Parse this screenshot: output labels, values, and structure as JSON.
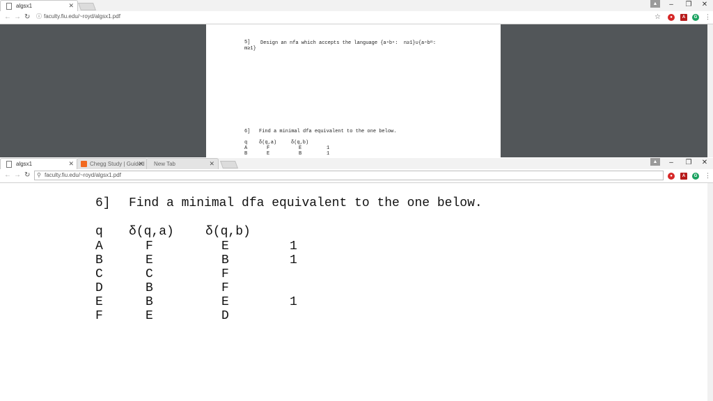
{
  "top_window": {
    "tabs": [
      {
        "title": "algsx1"
      }
    ],
    "url": "faculty.fiu.edu/~royd/algsx1.pdf",
    "pdf": {
      "problem5": {
        "number": "5]",
        "line1": "Design an nfa which accepts the language {aⁿbⁿ:  n≥1}∪{aⁿbᵐ:",
        "line2": "m≥1}"
      },
      "problem6": {
        "number": "6]",
        "text": "Find a minimal dfa equivalent to the one below.",
        "headers": [
          "q",
          "δ(q,a)",
          "δ(q,b)"
        ],
        "rows": [
          [
            "A",
            "F",
            "E",
            "1"
          ],
          [
            "B",
            "E",
            "B",
            "1"
          ]
        ]
      }
    }
  },
  "bottom_window": {
    "tabs": [
      {
        "title": "algsx1"
      },
      {
        "title": "Chegg Study | Guided So"
      },
      {
        "title": "New Tab"
      }
    ],
    "url": "faculty.fiu.edu/~royd/algsx1.pdf",
    "pdf": {
      "number": "6]",
      "text": "Find a minimal dfa equivalent to the one below.",
      "headers": [
        "q",
        "δ(q,a)",
        "δ(q,b)"
      ],
      "rows": [
        [
          "A",
          "F",
          "E",
          "1"
        ],
        [
          "B",
          "E",
          "B",
          "1"
        ],
        [
          "C",
          "C",
          "F",
          ""
        ],
        [
          "D",
          "B",
          "F",
          ""
        ],
        [
          "E",
          "B",
          "E",
          "1"
        ],
        [
          "F",
          "E",
          "D",
          ""
        ]
      ]
    }
  },
  "icons": {
    "close": "close-icon",
    "back": "back-arrow-icon",
    "forward": "forward-arrow-icon",
    "reload": "reload-icon",
    "star": "star-icon",
    "menu": "kebab-menu-icon"
  },
  "colors": {
    "viewer_bg": "#525659",
    "page_bg": "#ffffff",
    "chegg": "#f26a21"
  }
}
